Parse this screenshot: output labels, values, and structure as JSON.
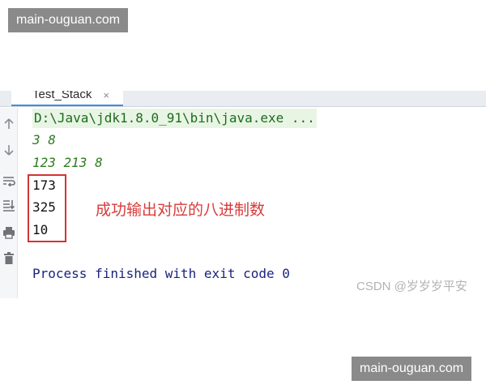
{
  "watermark": {
    "text": "main-ouguan.com"
  },
  "tab": {
    "label": "Test_Stack",
    "close": "×"
  },
  "console": {
    "command": "D:\\Java\\jdk1.8.0_91\\bin\\java.exe ...",
    "input_1": "3 8",
    "input_2": "123 213 8",
    "outputs": [
      "173",
      "325",
      "10"
    ],
    "finish": "Process finished with exit code 0"
  },
  "annotation": "成功输出对应的八进制数",
  "csdn": "CSDN @岁岁岁平安",
  "icons": [
    "arrow-up-icon",
    "arrow-down-icon",
    "soft-wrap-icon",
    "scroll-to-end-icon",
    "print-icon",
    "trash-icon"
  ],
  "colors": {
    "command": "#1e6b1e",
    "input": "#2f7d20",
    "finish": "#1a237e",
    "highlight": "#d33434"
  }
}
